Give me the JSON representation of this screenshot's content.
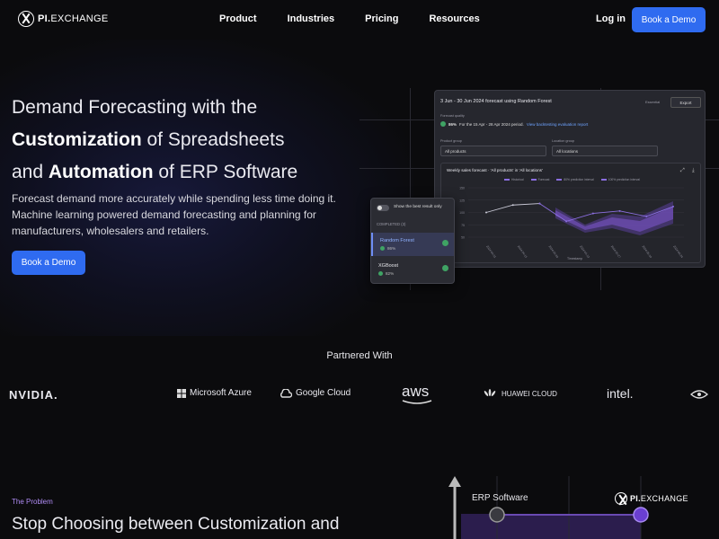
{
  "nav": {
    "brand": {
      "bold": "PI.",
      "rest": "EXCHANGE"
    },
    "links": [
      "Product",
      "Industries",
      "Pricing",
      "Resources"
    ],
    "login": "Log in",
    "cta": "Book a Demo"
  },
  "hero": {
    "title_line1": "Demand Forecasting with the",
    "title_line2_bold": "Customization",
    "title_line2_rest": " of Spreadsheets",
    "title_line3_pre": "and ",
    "title_line3_bold": "Automation",
    "title_line3_rest": " of ERP Software",
    "subtitle": "Forecast demand more accurately while spending less time doing it. Machine learning powered demand forecasting and planning for manufacturers, wholesalers and retailers.",
    "cta": "Book a Demo"
  },
  "mockup": {
    "title": "3 Jun - 30 Jun 2024 forecast using Random Forest",
    "tag": "Essential",
    "export": "Export",
    "quality_label": "Forecast quality",
    "quality_value": "86%",
    "quality_note": "For the 15 Apr - 28 Apr 2024 period.",
    "quality_link": "View backtesting evaluation report",
    "filters": [
      {
        "label": "Product group",
        "value": "All products"
      },
      {
        "label": "Location group",
        "value": "All locations"
      }
    ],
    "chart_title": "Weekly sales forecast · 'All products' in 'All locations'",
    "legend": [
      "Historical",
      "Forecast",
      "80% prediction interval",
      "100% prediction interval"
    ],
    "x_axis_label": "Timestamp",
    "y_ticks": [
      "150",
      "125",
      "100",
      "75",
      "50"
    ],
    "x_ticks": [
      "2024-04-01",
      "2024-04-15",
      "2024-04-29",
      "2024-05-13",
      "2024-05-27",
      "2024-06-10",
      "2024-06-24"
    ]
  },
  "chart_data": {
    "type": "line",
    "title": "Weekly sales forecast · 'All products' in 'All locations'",
    "xlabel": "Timestamp",
    "ylabel": "",
    "series": [
      {
        "name": "Historical",
        "values": [
          100,
          115,
          118
        ]
      },
      {
        "name": "Forecast",
        "values": [
          null,
          null,
          118,
          82,
          98,
          103,
          92,
          112
        ]
      }
    ]
  },
  "popover": {
    "toggle_label": "Show the best result only",
    "section_label": "COMPLETED (3)",
    "items": [
      {
        "name": "Random Forest",
        "score": "86%",
        "selected": true
      },
      {
        "name": "XGBoost",
        "score": "82%",
        "selected": false
      }
    ]
  },
  "partners": {
    "label": "Partnered With",
    "logos": [
      "NVIDIA.",
      "Microsoft Azure",
      "Google Cloud",
      "aws",
      "HUAWEI CLOUD",
      "intel."
    ]
  },
  "problem": {
    "tag": "The Problem",
    "title": "Stop Choosing between Customization and",
    "viz_erp": "ERP Software",
    "viz_brand": {
      "bold": "PI.",
      "rest": "EXCHANGE"
    }
  },
  "colors": {
    "accent": "#2f6bf0",
    "forecast": "#8b6ee0",
    "success": "#3fa364",
    "background": "#0b0b0d"
  }
}
